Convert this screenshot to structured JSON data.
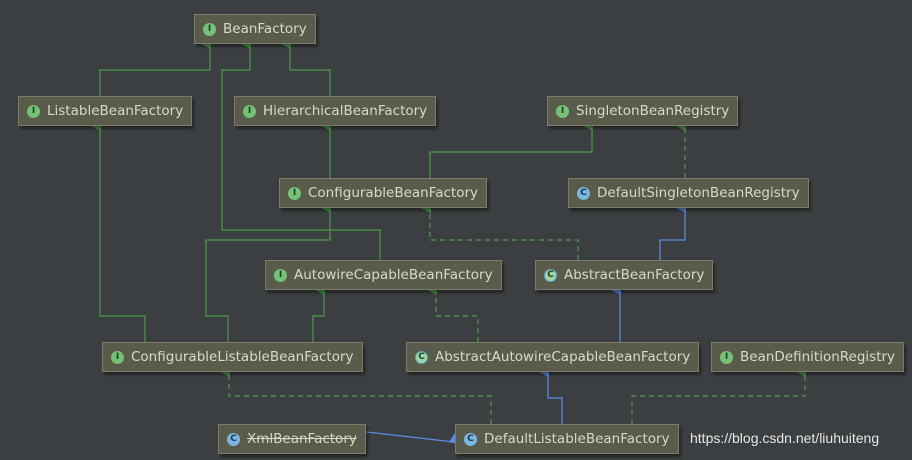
{
  "nodes": {
    "bean_factory": {
      "label": "BeanFactory",
      "kind": "interface",
      "badge": "I"
    },
    "listable_bean_factory": {
      "label": "ListableBeanFactory",
      "kind": "interface",
      "badge": "I"
    },
    "hierarchical_bean_factory": {
      "label": "HierarchicalBeanFactory",
      "kind": "interface",
      "badge": "I"
    },
    "singleton_bean_registry": {
      "label": "SingletonBeanRegistry",
      "kind": "interface",
      "badge": "I"
    },
    "configurable_bean_factory": {
      "label": "ConfigurableBeanFactory",
      "kind": "interface",
      "badge": "I"
    },
    "default_singleton_bean_registry": {
      "label": "DefaultSingletonBeanRegistry",
      "kind": "class",
      "badge": "C"
    },
    "autowire_capable_bean_factory": {
      "label": "AutowireCapableBeanFactory",
      "kind": "interface",
      "badge": "I"
    },
    "abstract_bean_factory": {
      "label": "AbstractBeanFactory",
      "kind": "abstract-class",
      "badge": "C"
    },
    "configurable_listable_bean_factory": {
      "label": "ConfigurableListableBeanFactory",
      "kind": "interface",
      "badge": "I"
    },
    "abstract_autowire_capable_bean_factory": {
      "label": "AbstractAutowireCapableBeanFactory",
      "kind": "abstract-class",
      "badge": "C"
    },
    "bean_definition_registry": {
      "label": "BeanDefinitionRegistry",
      "kind": "interface",
      "badge": "I"
    },
    "xml_bean_factory": {
      "label": "XmlBeanFactory",
      "kind": "class-deprecated",
      "badge": "C"
    },
    "default_listable_bean_factory": {
      "label": "DefaultListableBeanFactory",
      "kind": "class",
      "badge": "C"
    }
  },
  "watermark": "https://blog.csdn.net/liuhuiteng",
  "colors": {
    "background": "#3c3f41",
    "node_fill": "#5a5b4b",
    "extends_interface": "#4e9a4c",
    "implements_interface": "#4e9a4c",
    "extends_class": "#5b8ee6",
    "interface_badge": "#74c17a",
    "class_badge": "#7ab6e0"
  },
  "legend_semantics": {
    "solid_green": "interface extends interface",
    "dashed_green": "class implements interface",
    "solid_blue": "class extends class"
  }
}
